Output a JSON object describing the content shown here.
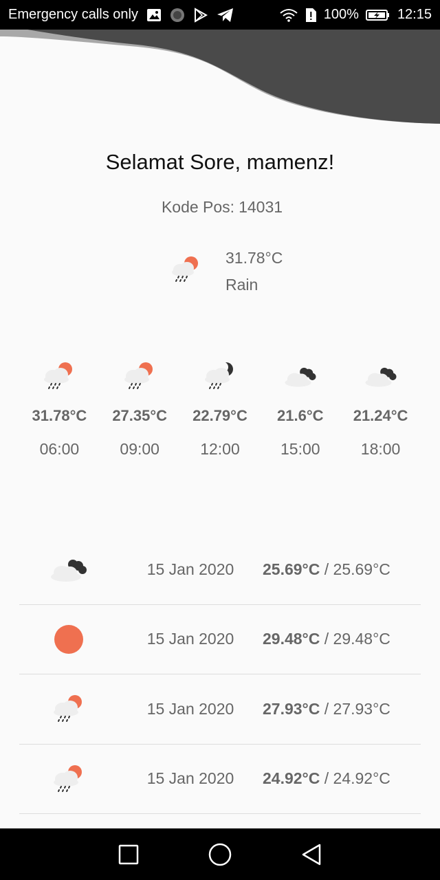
{
  "status_bar": {
    "carrier": "Emergency calls only",
    "battery": "100%",
    "time": "12:15"
  },
  "greeting": "Selamat Sore, mamenz!",
  "postal": {
    "label": "Kode Pos:",
    "value": "14031"
  },
  "current": {
    "temperature": "31.78°C",
    "condition": "Rain",
    "icon": "rain-sun-icon"
  },
  "hourly": [
    {
      "icon": "rain-sun-icon",
      "temp": "31.78°C",
      "time": "06:00"
    },
    {
      "icon": "rain-sun-icon",
      "temp": "27.35°C",
      "time": "09:00"
    },
    {
      "icon": "rain-moon-icon",
      "temp": "22.79°C",
      "time": "12:00"
    },
    {
      "icon": "cloudy-night-icon",
      "temp": "21.6°C",
      "time": "15:00"
    },
    {
      "icon": "cloudy-night-icon",
      "temp": "21.24°C",
      "time": "18:00"
    }
  ],
  "daily": [
    {
      "icon": "cloudy-night-icon",
      "date": "15 Jan 2020",
      "max": "25.69°C",
      "separator": "/",
      "min": "25.69°C"
    },
    {
      "icon": "sun-icon",
      "date": "15 Jan 2020",
      "max": "29.48°C",
      "separator": "/",
      "min": "29.48°C"
    },
    {
      "icon": "rain-sun-icon",
      "date": "15 Jan 2020",
      "max": "27.93°C",
      "separator": "/",
      "min": "27.93°C"
    },
    {
      "icon": "rain-sun-icon",
      "date": "15 Jan 2020",
      "max": "24.92°C",
      "separator": "/",
      "min": "24.92°C"
    }
  ],
  "colors": {
    "accent": "#ef7050",
    "dark_cloud": "#333333",
    "wave": "#4a4a4a",
    "wave_light": "#a8a8a8",
    "background": "#fafafa"
  }
}
